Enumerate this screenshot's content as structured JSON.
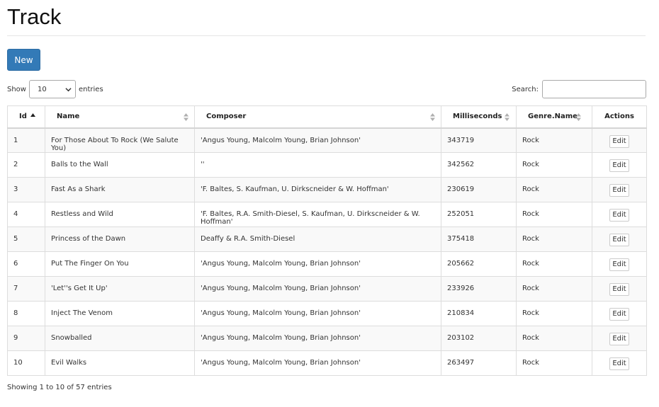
{
  "page": {
    "title": "Track"
  },
  "toolbar": {
    "new_label": "New"
  },
  "length": {
    "show_label": "Show",
    "value": "10",
    "entries_label": "entries"
  },
  "search": {
    "label": "Search:",
    "value": ""
  },
  "table": {
    "headers": [
      "Id",
      "Name",
      "Composer",
      "Milliseconds",
      "Genre.Name",
      "Actions"
    ],
    "edit_label": "Edit",
    "rows": [
      [
        "1",
        "For Those About To Rock (We Salute You)",
        "'Angus Young, Malcolm Young, Brian Johnson'",
        "343719",
        "Rock"
      ],
      [
        "2",
        "Balls to the Wall",
        "''",
        "342562",
        "Rock"
      ],
      [
        "3",
        "Fast As a Shark",
        "'F. Baltes, S. Kaufman, U. Dirkscneider & W. Hoffman'",
        "230619",
        "Rock"
      ],
      [
        "4",
        "Restless and Wild",
        "'F. Baltes, R.A. Smith-Diesel, S. Kaufman, U. Dirkscneider & W. Hoffman'",
        "252051",
        "Rock"
      ],
      [
        "5",
        "Princess of the Dawn",
        "Deaffy & R.A. Smith-Diesel",
        "375418",
        "Rock"
      ],
      [
        "6",
        "Put The Finger On You",
        "'Angus Young, Malcolm Young, Brian Johnson'",
        "205662",
        "Rock"
      ],
      [
        "7",
        "'Let''s Get It Up'",
        "'Angus Young, Malcolm Young, Brian Johnson'",
        "233926",
        "Rock"
      ],
      [
        "8",
        "Inject The Venom",
        "'Angus Young, Malcolm Young, Brian Johnson'",
        "210834",
        "Rock"
      ],
      [
        "9",
        "Snowballed",
        "'Angus Young, Malcolm Young, Brian Johnson'",
        "203102",
        "Rock"
      ],
      [
        "10",
        "Evil Walks",
        "'Angus Young, Malcolm Young, Brian Johnson'",
        "263497",
        "Rock"
      ]
    ]
  },
  "footer": {
    "info": "Showing 1 to 10 of 57 entries"
  },
  "colors": {
    "primary": "#337ab7",
    "stripe": "#f9f9f9",
    "border": "#dddddd"
  }
}
